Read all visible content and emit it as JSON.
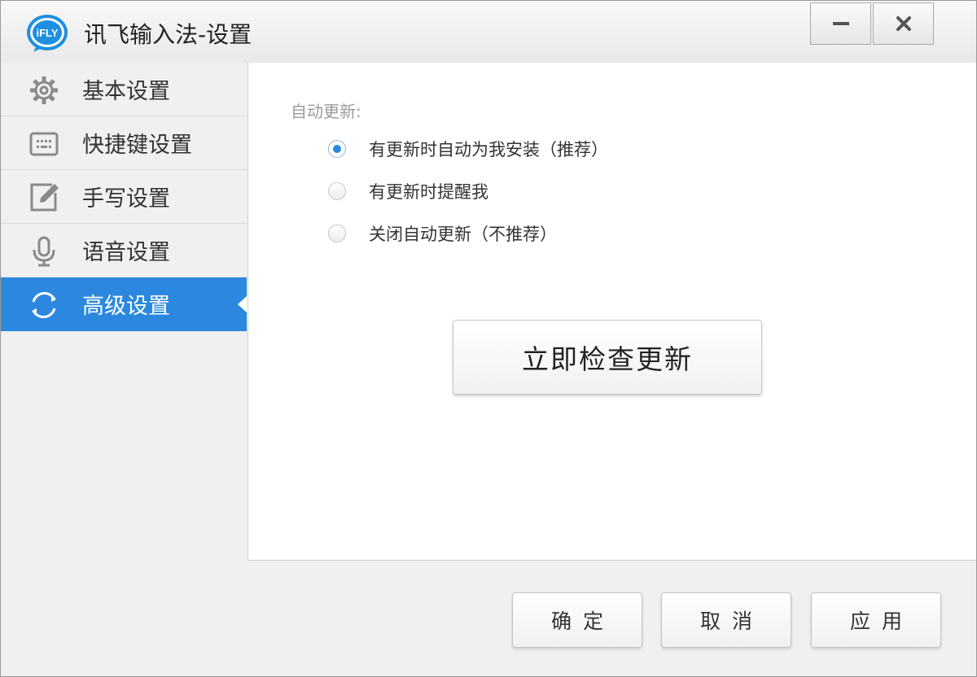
{
  "window": {
    "title": "讯飞输入法-设置",
    "logo_text": "iFLY",
    "controls": {
      "minimize": "minimize-icon",
      "close": "close-icon"
    }
  },
  "sidebar": {
    "items": [
      {
        "label": "基本设置",
        "icon": "gear-icon",
        "active": false
      },
      {
        "label": "快捷键设置",
        "icon": "keyboard-icon",
        "active": false
      },
      {
        "label": "手写设置",
        "icon": "pen-icon",
        "active": false
      },
      {
        "label": "语音设置",
        "icon": "microphone-icon",
        "active": false
      },
      {
        "label": "高级设置",
        "icon": "refresh-icon",
        "active": true
      }
    ]
  },
  "content": {
    "section_label": "自动更新:",
    "options": [
      {
        "label": "有更新时自动为我安装（推荐）",
        "checked": true
      },
      {
        "label": "有更新时提醒我",
        "checked": false
      },
      {
        "label": "关闭自动更新（不推荐）",
        "checked": false
      }
    ],
    "check_button": "立即检查更新"
  },
  "footer": {
    "ok": "确定",
    "cancel": "取消",
    "apply": "应用"
  },
  "colors": {
    "accent": "#2b88de",
    "logo_blue": "#1f8fe0"
  }
}
